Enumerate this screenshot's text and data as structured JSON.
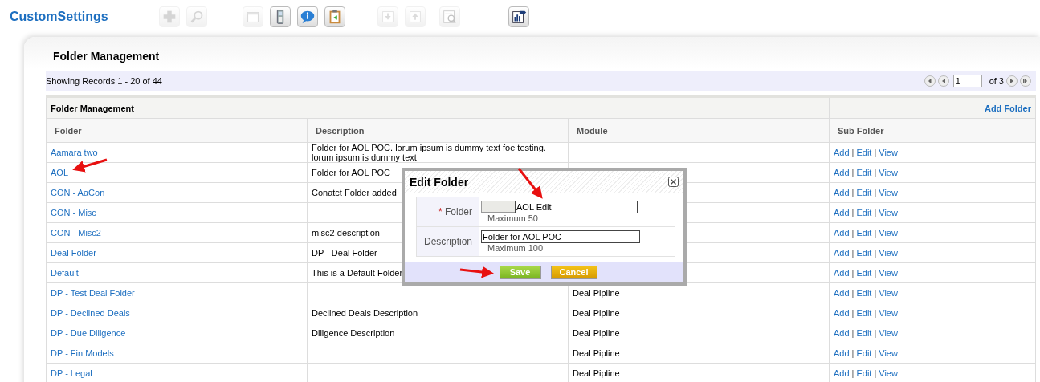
{
  "app_title": "CustomSettings",
  "toolbar": [
    [
      {
        "kind": "add",
        "disabled": true
      },
      {
        "kind": "search",
        "disabled": true
      }
    ],
    [
      {
        "kind": "calendar",
        "disabled": true
      },
      {
        "kind": "phone",
        "disabled": false
      },
      {
        "kind": "info",
        "disabled": false
      },
      {
        "kind": "clipboard",
        "disabled": false
      }
    ],
    [
      {
        "kind": "down",
        "disabled": true
      },
      {
        "kind": "up",
        "disabled": true
      }
    ],
    [
      {
        "kind": "preview",
        "disabled": true
      }
    ],
    [
      {
        "kind": "report",
        "disabled": false
      }
    ]
  ],
  "panel_title": "Folder Management",
  "pager": {
    "summary": "Showing Records 1 - 20 of 44",
    "page": "1",
    "of_pages": "of 3"
  },
  "table": {
    "group_title": "Folder Management",
    "add_link": "Add Folder",
    "columns": [
      "Folder",
      "Description",
      "Module",
      "Sub Folder"
    ],
    "rows": [
      {
        "folder": "Aamara two",
        "description": "Folder for AOL POC. lorum ipsum is dummy text foe testing. lorum ipsum is dummy text",
        "module": "",
        "sub_folder": {
          "links": [
            "Add",
            "Edit",
            "View"
          ],
          "separator": "|"
        }
      },
      {
        "folder": "AOL",
        "description": "Folder for AOL POC",
        "module": "",
        "sub_folder": {
          "links": [
            "Add",
            "Edit",
            "View"
          ],
          "separator": "|"
        }
      },
      {
        "folder": "CON - AaCon",
        "description": "Conatct Folder added",
        "module": "",
        "sub_folder": {
          "links": [
            "Add",
            "Edit",
            "View"
          ],
          "separator": "|"
        }
      },
      {
        "folder": "CON - Misc",
        "description": "",
        "module": "",
        "sub_folder": {
          "links": [
            "Add",
            "Edit",
            "View"
          ],
          "separator": "|"
        }
      },
      {
        "folder": "CON - Misc2",
        "description": "misc2 description",
        "module": "",
        "sub_folder": {
          "links": [
            "Add",
            "Edit",
            "View"
          ],
          "separator": "|"
        }
      },
      {
        "folder": "Deal Folder",
        "description": "DP - Deal Folder",
        "module": "",
        "sub_folder": {
          "links": [
            "Add",
            "Edit",
            "View"
          ],
          "separator": "|"
        }
      },
      {
        "folder": "Default",
        "description": "This is a Default Folder",
        "module": "",
        "sub_folder": {
          "links": [
            "Add",
            "Edit",
            "View"
          ],
          "separator": "|"
        }
      },
      {
        "folder": "DP - Test Deal Folder",
        "description": "",
        "module": "Deal Pipline",
        "sub_folder": {
          "links": [
            "Add",
            "Edit",
            "View"
          ],
          "separator": "|"
        }
      },
      {
        "folder": "DP - Declined Deals",
        "description": "Declined Deals Description",
        "module": "Deal Pipline",
        "sub_folder": {
          "links": [
            "Add",
            "Edit",
            "View"
          ],
          "separator": "|"
        }
      },
      {
        "folder": "DP - Due Diligence",
        "description": "Diligence Description",
        "module": "Deal Pipline",
        "sub_folder": {
          "links": [
            "Add",
            "Edit",
            "View"
          ],
          "separator": "|"
        }
      },
      {
        "folder": "DP - Fin Models",
        "description": "",
        "module": "Deal Pipline",
        "sub_folder": {
          "links": [
            "Add",
            "Edit",
            "View"
          ],
          "separator": "|"
        }
      },
      {
        "folder": "DP - Legal",
        "description": "",
        "module": "Deal Pipline",
        "sub_folder": {
          "links": [
            "Add",
            "Edit",
            "View"
          ],
          "separator": "|"
        }
      }
    ]
  },
  "dialog": {
    "title": "Edit Folder",
    "fields": [
      {
        "label": "Folder",
        "required_mark": "*",
        "value": "AOL Edit",
        "hint": "Maximum 50",
        "prefix_box": true
      },
      {
        "label": "Description",
        "value": "Folder for AOL POC",
        "hint": "Maximum 100",
        "prefix_box": false
      }
    ],
    "buttons": [
      {
        "kind": "primary",
        "label": "Save"
      },
      {
        "kind": "secondary",
        "label": "Cancel"
      }
    ]
  }
}
